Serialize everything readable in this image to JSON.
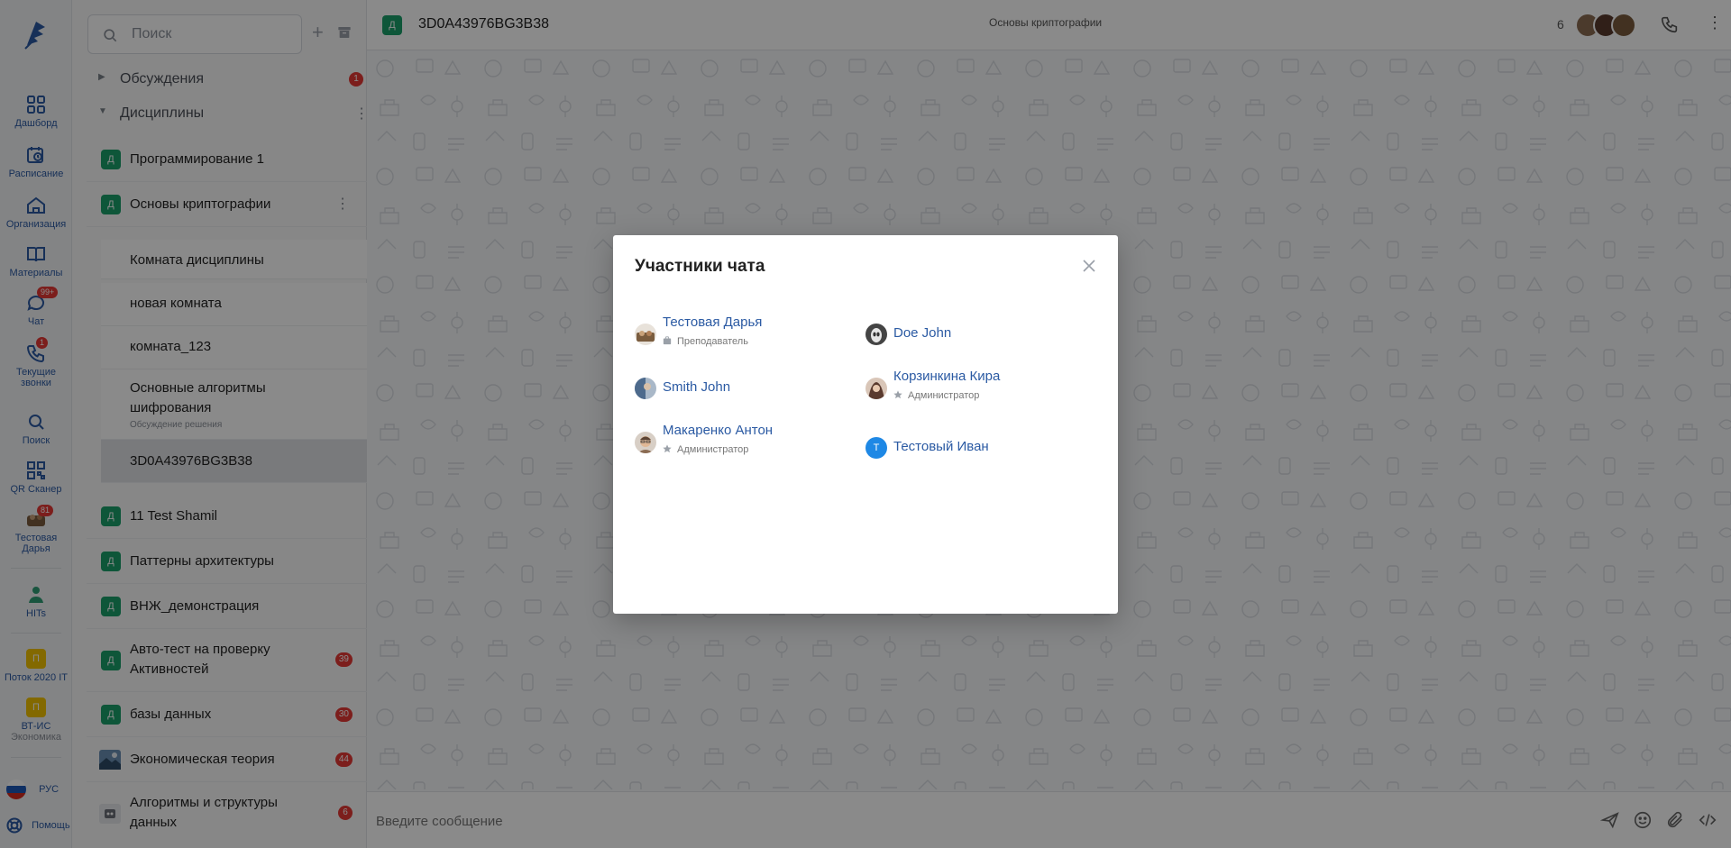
{
  "rail": {
    "items": [
      {
        "label": "Дашборд",
        "icon": "grid-icon"
      },
      {
        "label": "Расписание",
        "icon": "calendar-clock-icon"
      },
      {
        "label": "Организация",
        "icon": "home-icon"
      },
      {
        "label": "Материалы",
        "icon": "book-icon"
      },
      {
        "label": "Чат",
        "icon": "chat-icon",
        "badge": "99+"
      },
      {
        "label": "Текущие звонки",
        "icon": "phone-icon",
        "badge": "1"
      },
      {
        "label": "Поиск",
        "icon": "search-icon"
      },
      {
        "label": "QR Сканер",
        "icon": "qr-icon"
      },
      {
        "label": "Тестовая Дарья",
        "icon": "avatar-icon",
        "badge": "81"
      },
      {
        "label": "HITs",
        "icon": "person-icon"
      }
    ],
    "orgs": [
      {
        "letter": "П",
        "label": "Поток 2020 IT"
      },
      {
        "letter": "П",
        "label": "ВТ-ИС",
        "sublabel": "Экономика"
      }
    ],
    "lang": "РУС",
    "help": "Помощь"
  },
  "sidebar": {
    "search_placeholder": "Поиск",
    "discussions": {
      "label": "Обсуждения",
      "count": "1"
    },
    "disciplines": {
      "label": "Дисциплины"
    },
    "items": [
      {
        "badge": "Д",
        "title": "Программирование 1"
      },
      {
        "badge": "Д",
        "title": "Основы криптографии"
      },
      {
        "badge": "Д",
        "title": "11 Test Shamil"
      },
      {
        "badge": "Д",
        "title": "Паттерны архитектуры"
      },
      {
        "badge": "Д",
        "title": "ВНЖ_демонстрация"
      },
      {
        "badge": "Д",
        "title": "Авто-тест на проверку Активностей",
        "count": "39"
      },
      {
        "badge": "Д",
        "title": "базы данных",
        "count": "30"
      },
      {
        "badge": "",
        "title": "Экономическая теория",
        "count": "44"
      },
      {
        "badge": "",
        "title": "Алгоритмы и структуры данных",
        "count": "6"
      }
    ],
    "subrooms": [
      {
        "title": "Комната дисциплины"
      },
      {
        "title": "новая комната"
      },
      {
        "title": "комната_123"
      },
      {
        "title": "Основные алгоритмы шифрования",
        "hint": "Обсуждение решения"
      },
      {
        "title": "3D0A43976BG3B38"
      }
    ]
  },
  "chat": {
    "badge": "Д",
    "room_name": "3D0A43976BG3B38",
    "discipline": "Основы криптографии",
    "participant_count": "6",
    "composer_placeholder": "Введите сообщение"
  },
  "modal": {
    "title": "Участники чата",
    "members": [
      {
        "name": "Тестовая Дарья",
        "role": "Преподаватель",
        "role_icon": "briefcase-icon",
        "avatar_color": "#7a5c3e"
      },
      {
        "name": "Doe John",
        "role": "",
        "avatar_color": "#444444"
      },
      {
        "name": "Smith John",
        "role": "",
        "avatar_color": "#4d6a8c"
      },
      {
        "name": "Корзинкина Кира",
        "role": "Администратор",
        "role_icon": "star-icon",
        "avatar_color": "#5a3a2e"
      },
      {
        "name": "Макаренко Антон",
        "role": "Администратор",
        "role_icon": "star-icon",
        "avatar_color": "#8b6b52"
      },
      {
        "name": "Тестовый Иван",
        "role": "",
        "avatar_letter": "Т",
        "avatar_color": "#1e88e5"
      }
    ]
  },
  "colors": {
    "accent": "#2b5aa3",
    "discipline_badge": "#1aa06a",
    "alert": "#e53935"
  }
}
